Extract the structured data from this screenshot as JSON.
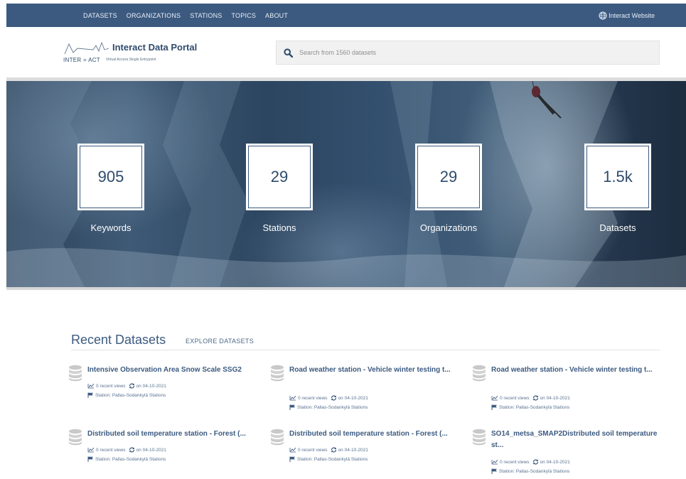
{
  "nav": {
    "items": [
      "DATASETS",
      "ORGANIZATIONS",
      "STATIONS",
      "TOPICS",
      "ABOUT"
    ],
    "external_label": "Interact Website"
  },
  "header": {
    "logo_brand": "INTER = ACT",
    "title": "Interact Data Portal",
    "tagline": "Virtual Access Single Entrypoint",
    "search_placeholder": "Search from 1560 datasets"
  },
  "stats": [
    {
      "value": "905",
      "label": "Keywords"
    },
    {
      "value": "29",
      "label": "Stations"
    },
    {
      "value": "29",
      "label": "Organizations"
    },
    {
      "value": "1.5k",
      "label": "Datasets"
    }
  ],
  "recent": {
    "heading": "Recent Datasets",
    "explore_label": "EXPLORE DATASETS",
    "cards": [
      {
        "title": "Intensive Observation Area Snow Scale SSG2",
        "views": "0 recent views",
        "date": "on 04-10-2021",
        "station": "Station: Pallas-Sodankylä Stations"
      },
      {
        "title": "Road weather station - Vehicle winter testing t...",
        "views": "0 recent views",
        "date": "on 04-10-2021",
        "station": "Station: Pallas-Sodankylä Stations"
      },
      {
        "title": "Road weather station - Vehicle winter testing t...",
        "views": "0 recent views",
        "date": "on 04-10-2021",
        "station": "Station: Pallas-Sodankylä Stations"
      },
      {
        "title": "Distributed soil temperature station - Forest (...",
        "views": "0 recent views",
        "date": "on 04-10-2021",
        "station": "Station: Pallas-Sodankylä Stations"
      },
      {
        "title": "Distributed soil temperature station - Forest (...",
        "views": "0 recent views",
        "date": "on 04-10-2021",
        "station": "Station: Pallas-Sodankylä Stations"
      },
      {
        "title": "SO14_metsa_SMAP2Distributed soil temperature st...",
        "views": "0 recent views",
        "date": "on 04-10-2021",
        "station": "Station: Pallas-Sodankylä Stations"
      }
    ]
  },
  "colors": {
    "nav_bg": "#3c5a80",
    "accent": "#3c5a80",
    "search_bg": "#f1f1f1"
  }
}
